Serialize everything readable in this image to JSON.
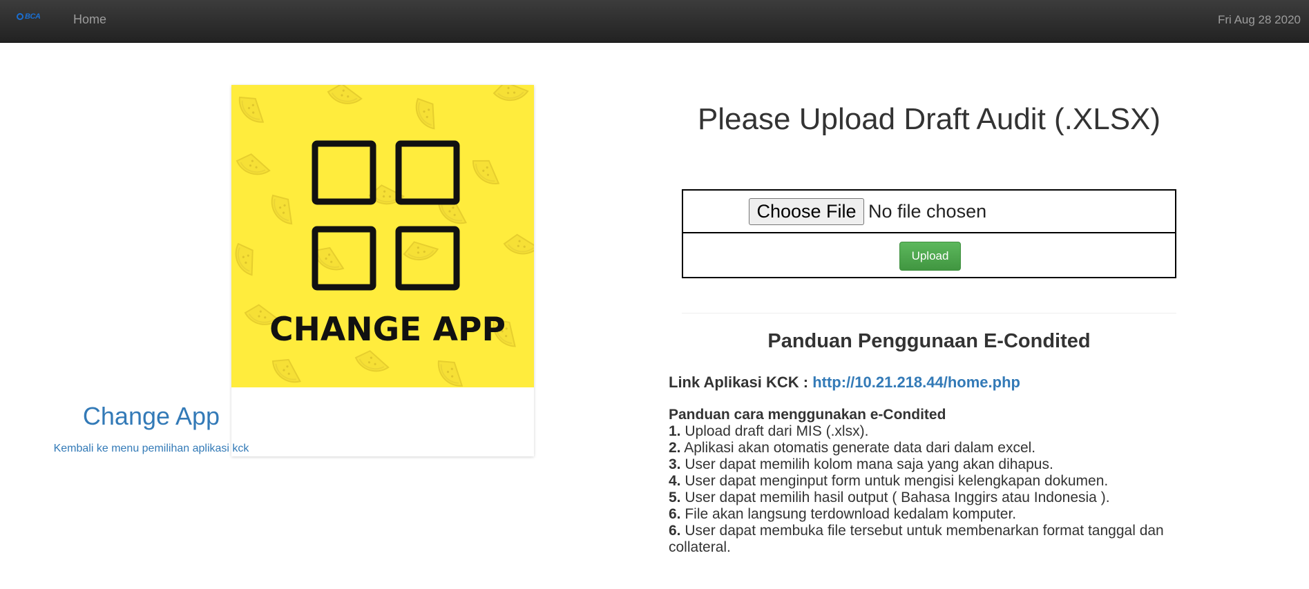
{
  "navbar": {
    "brand_text": "BCA",
    "home_label": "Home",
    "date": "Fri Aug 28 2020"
  },
  "card": {
    "image_label": "CHANGE APP",
    "image_icon": "grid-four-squares-icon",
    "title": "Change App",
    "subtitle": "Kembali ke menu pemilihan aplikasi kck",
    "colors": {
      "image_bg": "#ffec3d",
      "title": "#337ab7"
    }
  },
  "upload": {
    "title": "Please Upload Draft Audit (.XLSX)",
    "choose_file_label": "Choose File",
    "file_status": "No file chosen",
    "upload_label": "Upload",
    "colors": {
      "upload_button": "#5cb85c"
    }
  },
  "guide": {
    "title": "Panduan Penggunaan E-Condited",
    "link_label": "Link Aplikasi KCK : ",
    "link_url_text": "http://10.21.218.44/home.php",
    "steps_heading": "Panduan cara menggunakan e-Condited",
    "steps": [
      {
        "num": "1.",
        "text": " Upload draft dari MIS (.xlsx)."
      },
      {
        "num": "2.",
        "text": " Aplikasi akan otomatis generate data dari dalam excel."
      },
      {
        "num": "3.",
        "text": " User dapat memilih kolom mana saja yang akan dihapus."
      },
      {
        "num": "4.",
        "text": " User dapat menginput form untuk mengisi kelengkapan dokumen."
      },
      {
        "num": "5.",
        "text": " User dapat memilih hasil output ( Bahasa Inggirs atau Indonesia )."
      },
      {
        "num": "6.",
        "text": " File akan langsung terdownload kedalam komputer."
      },
      {
        "num": "6.",
        "text": " User dapat membuka file tersebut untuk membenarkan format tanggal dan collateral."
      }
    ]
  }
}
